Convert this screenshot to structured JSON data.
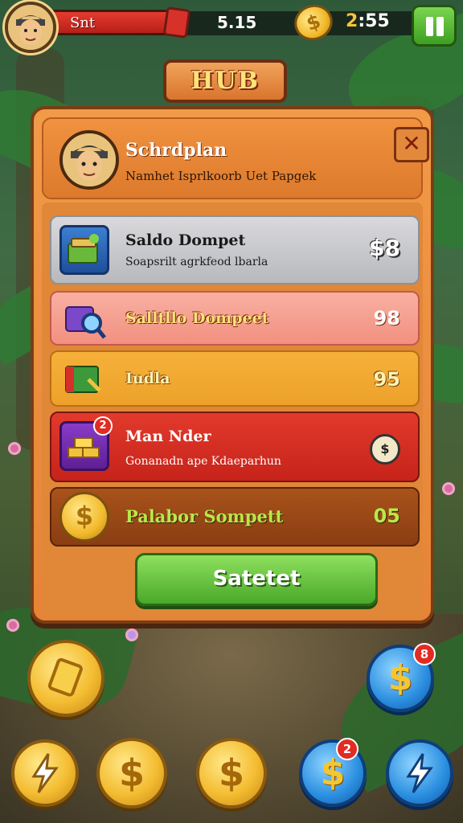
{
  "topbar": {
    "hp_label": "Snt",
    "score": "5.15",
    "timer_prefix": "2",
    "timer_rest": ":55"
  },
  "hub": {
    "title": "HUB"
  },
  "panel": {
    "header": {
      "name": "Schrdplan",
      "subtitle": "Namhet Isprlkoorb Uet Papgek",
      "close_label": "✕"
    },
    "rows": [
      {
        "title": "Saldo Dompet",
        "subtitle": "Soapsrilt agrkfeod lbarla",
        "value": "$8"
      },
      {
        "title": "Salltllo Dompeet",
        "value": "98"
      },
      {
        "title": "Iudla",
        "value": "95"
      },
      {
        "title": "Man Nder",
        "subtitle": "Gonanadn ape Kdaeparhun",
        "value": "$",
        "badge": "2"
      },
      {
        "title": "Palabor Sompett",
        "value": "05"
      }
    ],
    "select_label": "Satetet"
  },
  "bottom": {
    "coin_symbol": "$",
    "badge_right": "8",
    "badge_mid": "2"
  },
  "colors": {
    "accent_orange": "#e78336",
    "green_button": "#49a82a",
    "red_row": "#c6231a"
  }
}
